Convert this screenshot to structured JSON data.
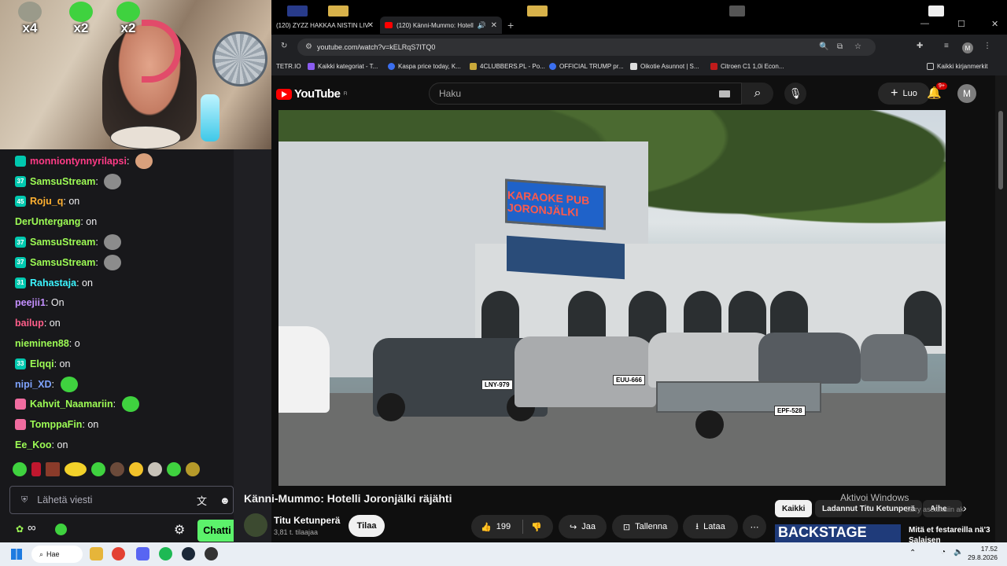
{
  "webcam": {
    "badges": [
      {
        "label": "x4",
        "color": "#9a9a8a"
      },
      {
        "label": "x2",
        "color": "#3fd23f"
      },
      {
        "label": "x2",
        "color": "#3fd23f"
      }
    ]
  },
  "chat": {
    "messages": [
      {
        "user": "monniontynnyrilapsi",
        "color": "#ff3b86",
        "text": "",
        "badge": "",
        "badgecolor": "#00c8af",
        "emote": "#d9a07c"
      },
      {
        "user": "SamsuStream",
        "color": "#9dfc55",
        "text": "",
        "badge": "37",
        "badgecolor": "#00c8af",
        "emote": "#8c8c8c"
      },
      {
        "user": "Roju_q",
        "color": "#ffb131",
        "text": "on",
        "badge": "45",
        "badgecolor": "#00c8af",
        "emote": ""
      },
      {
        "user": "DerUntergang",
        "color": "#9dfc55",
        "text": "on",
        "badge": "",
        "badgecolor": "",
        "emote": ""
      },
      {
        "user": "SamsuStream",
        "color": "#9dfc55",
        "text": "",
        "badge": "37",
        "badgecolor": "#00c8af",
        "emote": "#8c8c8c"
      },
      {
        "user": "SamsuStream",
        "color": "#9dfc55",
        "text": "",
        "badge": "37",
        "badgecolor": "#00c8af",
        "emote": "#8c8c8c"
      },
      {
        "user": "Rahastaja",
        "color": "#3cf5ff",
        "text": "on",
        "badge": "31",
        "badgecolor": "#00c8af",
        "emote": ""
      },
      {
        "user": "peejii1",
        "color": "#c490ff",
        "text": "On",
        "badge": "",
        "badgecolor": "",
        "emote": ""
      },
      {
        "user": "bailup",
        "color": "#ff5e8a",
        "text": "on",
        "badge": "",
        "badgecolor": "",
        "emote": ""
      },
      {
        "user": "nieminen88",
        "color": "#9dfc55",
        "text": "o",
        "badge": "",
        "badgecolor": "",
        "emote": ""
      },
      {
        "user": "Elqqi",
        "color": "#9dfc55",
        "text": "on",
        "badge": "33",
        "badgecolor": "#00c8af",
        "emote": ""
      },
      {
        "user": "nipi_XD",
        "color": "#7fa4ff",
        "text": "",
        "badge": "",
        "badgecolor": "",
        "emote": "#3fd23f"
      },
      {
        "user": "Kahvit_Naamariin",
        "color": "#9dfc55",
        "text": "",
        "badge": "",
        "badgecolor": "#f06ca0",
        "emote": "#3fd23f"
      },
      {
        "user": "TomppaFin",
        "color": "#9dfc55",
        "text": "on",
        "badge": "",
        "badgecolor": "#f06ca0",
        "emote": ""
      },
      {
        "user": "Ee_Koo",
        "color": "#9dfc55",
        "text": "on",
        "badge": "",
        "badgecolor": "",
        "emote": ""
      }
    ],
    "input_placeholder": "Lähetä viesti",
    "chat_button": "Chatti",
    "infinity": "∞"
  },
  "browser": {
    "tabs": [
      {
        "title": "(120) ZYZZ HAKKAA NISTIN LIV"
      },
      {
        "title": "(120) Känni-Mummo: Hotell"
      }
    ],
    "url": "youtube.com/watch?v=kELRqS7ITQ0",
    "bookmarks": [
      "TETR.IO",
      "Kaikki kategoriat - T...",
      "Kaspa price today, K...",
      "4CLUBBERS.PL - Po...",
      "OFFICIAL TRUMP pr...",
      "Oikotie Asunnot | S...",
      "Citroen C1 1,0i Econ...",
      "Kaikki kirjanmerkit"
    ],
    "avatar": "M"
  },
  "youtube": {
    "logo": "YouTube",
    "logo_region": "FI",
    "search_placeholder": "Haku",
    "create": "Luo",
    "notif_count": "9+",
    "avatar": "M",
    "video_sign": "KARAOKE PUB JORONJÄLKI",
    "plate1": "LNY-979",
    "plate2": "EUU-666",
    "plate3": "EPF-528",
    "title": "Känni-Mummo: Hotelli Joronjälki räjähti",
    "channel": "Titu Ketunperä",
    "subscribers": "3,81 t. tilaajaa",
    "subscribe": "Tilaa",
    "likes": "199",
    "share": "Jaa",
    "save": "Tallenna",
    "download": "Lataa",
    "chips": [
      "Kaikki",
      "Ladannut Titu Ketunperä",
      "Aihe"
    ],
    "related_thumb": "BACKSTAGE",
    "related_title": "Mitä et festareilla nä'3 Salaisen"
  },
  "windows": {
    "activate": "Aktivoi Windows",
    "activate_sub": "Siirry asetuksiin aktivoidaksesi Windows.",
    "search": "Hae",
    "time": "17.52",
    "date": "29.8.2026"
  }
}
